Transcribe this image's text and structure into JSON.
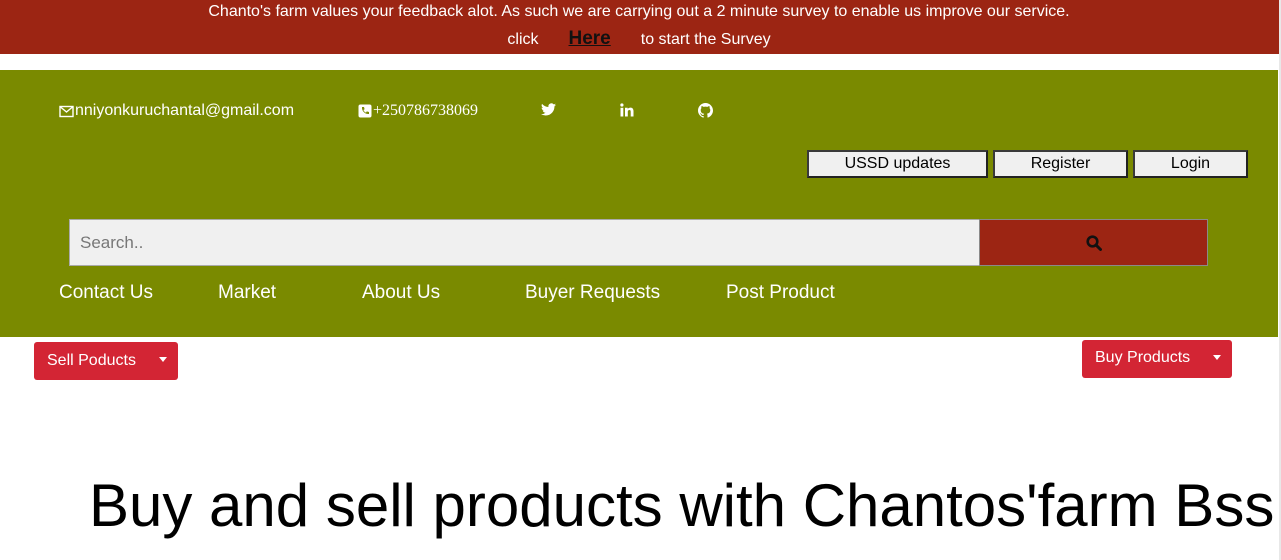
{
  "banner": {
    "message": "Chanto's farm values your feedback alot. As such we are carrying out a 2 minute survey to enable us improve our service.",
    "prefix": "click",
    "link": "Here",
    "suffix": "to start the Survey"
  },
  "contact": {
    "email": "nniyonkuruchantal@gmail.com",
    "phone": "+250786738069"
  },
  "social": [
    "twitter-icon",
    "linkedin-icon",
    "github-icon"
  ],
  "buttons": {
    "ussd": "USSD updates",
    "register": "Register",
    "login": "Login"
  },
  "search": {
    "placeholder": "Search.."
  },
  "nav": [
    "Contact Us",
    "Market",
    "About Us",
    "Buyer Requests",
    "Post Product"
  ],
  "dropdowns": {
    "sell": "Sell Poducts",
    "buy": "Buy Products"
  },
  "hero": {
    "title": "Buy and sell products with Chantos'farm Bss"
  },
  "colors": {
    "banner": "#9c2513",
    "header": "#7a8a00",
    "dropdown": "#d32534",
    "search_button": "#9c2513"
  }
}
